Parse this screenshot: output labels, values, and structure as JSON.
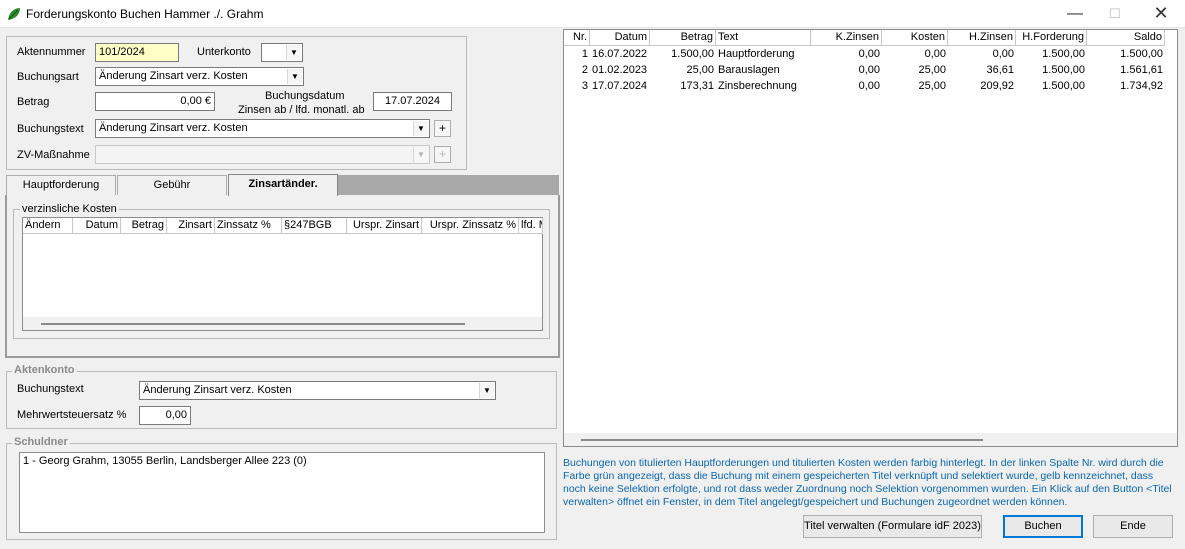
{
  "window": {
    "title": "Forderungskonto Buchen Hammer ./. Grahm",
    "minimize_symbol": "—",
    "maximize_symbol": "☐",
    "close_symbol": "✕",
    "icon": "leaf-icon"
  },
  "form": {
    "aktennummer_label": "Aktennummer",
    "aktennummer_value": "101/2024",
    "unterkonto_label": "Unterkonto",
    "unterkonto_value": "",
    "buchungsart_label": "Buchungsart",
    "buchungsart_value": "Änderung Zinsart verz. Kosten",
    "betrag_label": "Betrag",
    "betrag_value": "0,00 €",
    "buchungsdatum_label": "Buchungsdatum",
    "zinsen_ab_label": "Zinsen ab / lfd. monatl. ab",
    "buchungsdatum_value": "17.07.2024",
    "buchungstext_label": "Buchungstext",
    "buchungstext_value": "Änderung Zinsart verz. Kosten",
    "zv_label": "ZV-Maßnahme",
    "zv_value": "",
    "plus_symbol": "+"
  },
  "tabs": [
    {
      "label": "Hauptforderung"
    },
    {
      "label": "Gebühr"
    },
    {
      "label": "Zinsartänder."
    }
  ],
  "verzinsliche_kosten": {
    "group_label": "verzinsliche Kosten",
    "columns": [
      "Ändern",
      "Datum",
      "Betrag",
      "Zinsart",
      "Zinssatz %",
      "§247BGB",
      "Urspr. Zinsart",
      "Urspr. Zinssatz %",
      "lfd. M"
    ]
  },
  "aktenkonto": {
    "group_label": "Aktenkonto",
    "buchungstext_label": "Buchungstext",
    "buchungstext_value": "Änderung Zinsart verz. Kosten",
    "mwst_label": "Mehrwertsteuersatz %",
    "mwst_value": "0,00"
  },
  "schuldner": {
    "group_label": "Schuldner",
    "items": [
      "1 - Georg Grahm, 13055 Berlin, Landsberger Allee 223 (0)"
    ]
  },
  "ledger": {
    "columns": [
      "Nr.",
      "Datum",
      "Betrag",
      "Text",
      "K.Zinsen",
      "Kosten",
      "H.Zinsen",
      "H.Forderung",
      "Saldo"
    ],
    "rows": [
      [
        "1",
        "16.07.2022",
        "1.500,00",
        "Hauptforderung",
        "0,00",
        "0,00",
        "0,00",
        "1.500,00",
        "1.500,00"
      ],
      [
        "2",
        "01.02.2023",
        "25,00",
        "Barauslagen",
        "0,00",
        "25,00",
        "36,61",
        "1.500,00",
        "1.561,61"
      ],
      [
        "3",
        "17.07.2024",
        "173,31",
        "Zinsberechnung",
        "0,00",
        "25,00",
        "209,92",
        "1.500,00",
        "1.734,92"
      ]
    ]
  },
  "info_text": "Buchungen von titulierten Hauptforderungen und titulierten Kosten werden farbig hinterlegt. In der linken Spalte Nr. wird durch die Farbe grün angezeigt, dass die Buchung mit einem gespeicherten Titel verknüpft und selektiert wurde, gelb kennzeichnet, dass noch keine Selektion erfolgte, und rot dass weder Zuordnung noch Selektion vorgenommen wurden. Ein Klick auf den Button <Titel verwalten> öffnet ein Fenster, in dem Titel angelegt/gespeichert und Buchungen zugeordnet werden können.",
  "buttons": {
    "titel_verwalten": "Titel verwalten (Formulare idF 2023)",
    "buchen": "Buchen",
    "ende": "Ende"
  },
  "colors": {
    "info_text": "#0a66b0",
    "aktennummer_bg": "#ffffc8"
  }
}
